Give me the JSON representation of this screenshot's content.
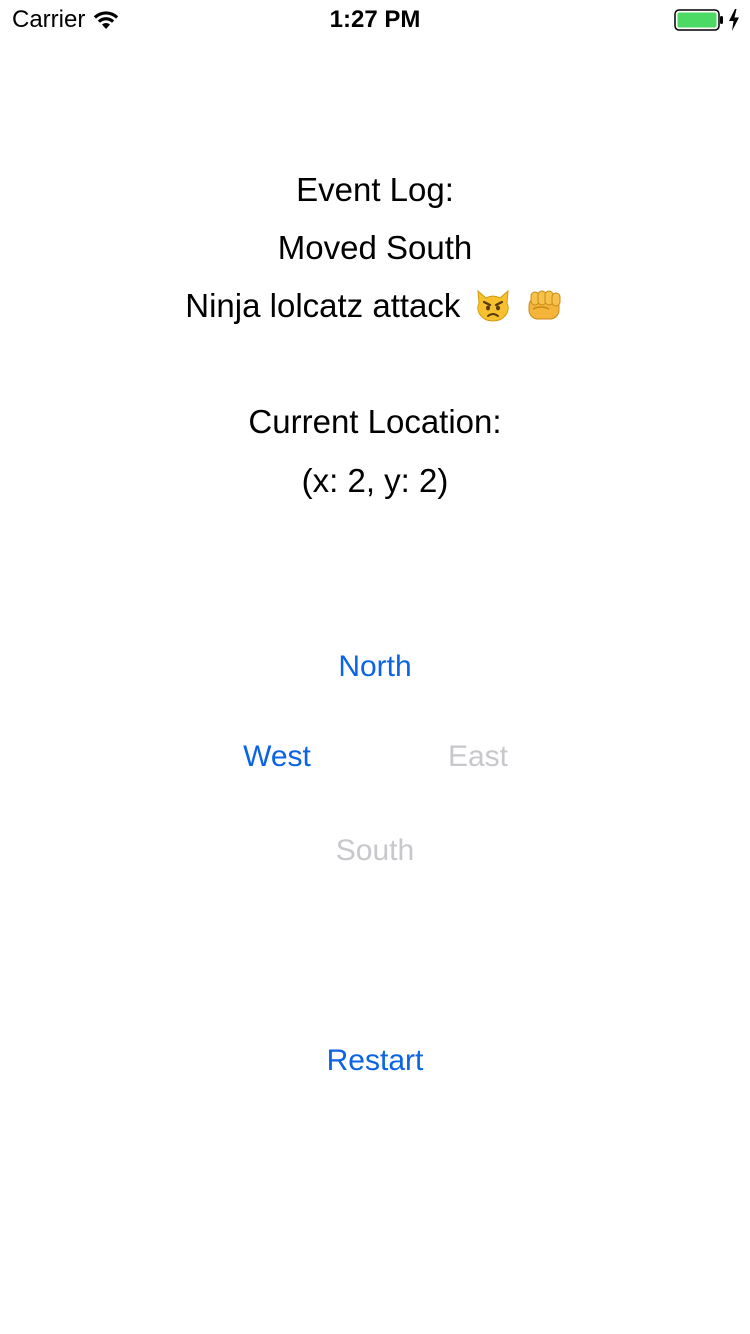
{
  "status_bar": {
    "carrier": "Carrier",
    "time": "1:27 PM",
    "wifi_icon": "wifi-icon",
    "battery_icon": "battery-icon",
    "charging_icon": "charging-bolt-icon",
    "battery_color": "#4cd964"
  },
  "event_log": {
    "heading": "Event Log:",
    "entries": [
      "Moved South",
      "Ninja lolcatz attack"
    ],
    "entry_emojis": [
      "pouting-cat-icon",
      "fist-bump-icon"
    ]
  },
  "location": {
    "heading": "Current Location:",
    "value": "(x: 2, y: 2)"
  },
  "controls": {
    "north": {
      "label": "North",
      "enabled": true
    },
    "west": {
      "label": "West",
      "enabled": true
    },
    "east": {
      "label": "East",
      "enabled": false
    },
    "south": {
      "label": "South",
      "enabled": false
    },
    "restart": {
      "label": "Restart",
      "enabled": true
    }
  },
  "colors": {
    "tint": "#0b63e5",
    "disabled": "#c7c7cc",
    "text": "#000000",
    "background": "#ffffff"
  }
}
